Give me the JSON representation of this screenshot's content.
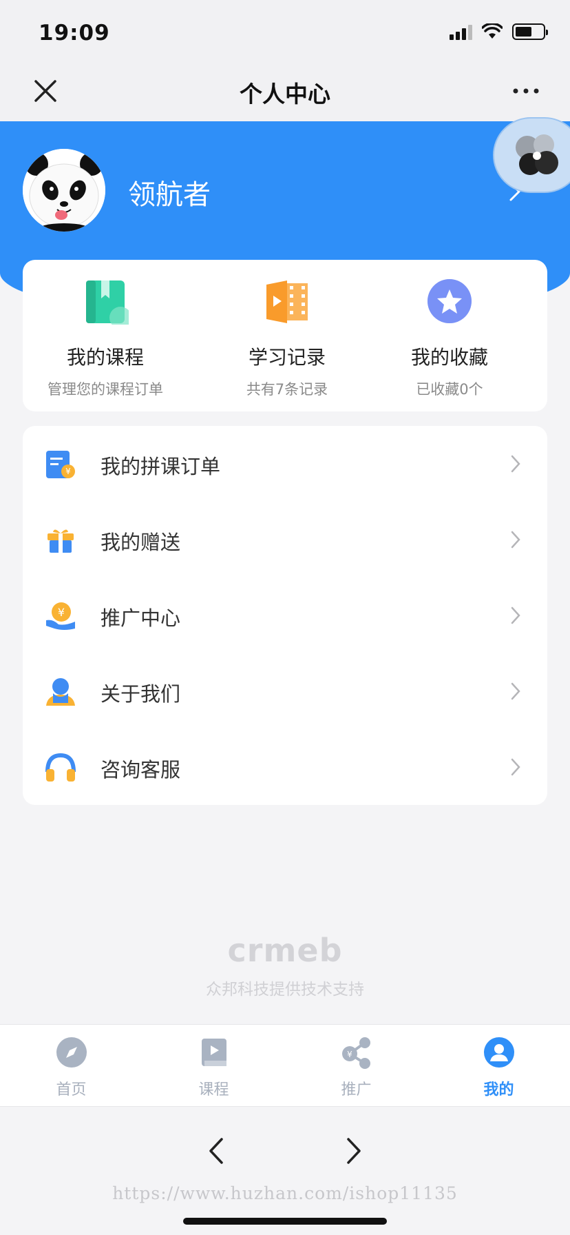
{
  "status_bar": {
    "time": "19:09"
  },
  "nav": {
    "title": "个人中心"
  },
  "profile": {
    "name": "领航者"
  },
  "quick_actions": [
    {
      "title": "我的课程",
      "subtitle": "管理您的课程订单",
      "icon": "course-book-icon",
      "color": "#2fd0a6"
    },
    {
      "title": "学习记录",
      "subtitle": "共有7条记录",
      "icon": "video-record-icon",
      "color": "#f99b2b"
    },
    {
      "title": "我的收藏",
      "subtitle": "已收藏0个",
      "icon": "star-collect-icon",
      "color": "#6d87f5"
    }
  ],
  "menu": [
    {
      "label": "我的拼课订单",
      "icon": "group-order-icon"
    },
    {
      "label": "我的赠送",
      "icon": "gift-icon"
    },
    {
      "label": "推广中心",
      "icon": "promotion-coin-icon"
    },
    {
      "label": "关于我们",
      "icon": "about-us-icon"
    },
    {
      "label": "咨询客服",
      "icon": "headset-icon"
    }
  ],
  "footer": {
    "logo": "crmeb",
    "support_text": "众邦科技提供技术支持"
  },
  "tabs": [
    {
      "label": "首页",
      "icon": "compass-icon",
      "active": false
    },
    {
      "label": "课程",
      "icon": "course-tab-icon",
      "active": false
    },
    {
      "label": "推广",
      "icon": "share-icon",
      "active": false
    },
    {
      "label": "我的",
      "icon": "user-icon",
      "active": true
    }
  ],
  "watermark": "https://www.huzhan.com/ishop11135",
  "colors": {
    "primary": "#2f8ff8",
    "background": "#f4f4f6"
  }
}
